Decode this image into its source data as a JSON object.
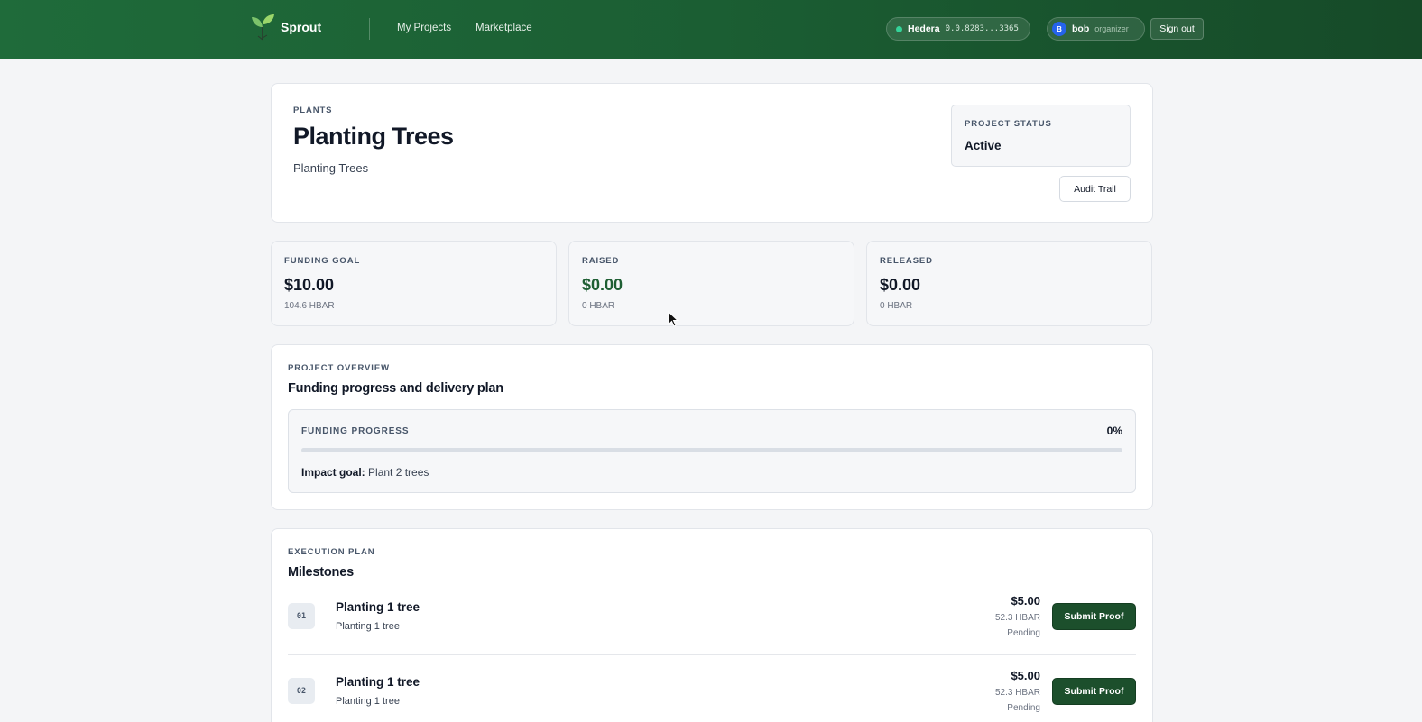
{
  "header": {
    "brand": "Sprout",
    "nav": [
      "My Projects",
      "Marketplace"
    ],
    "network": {
      "name": "Hedera",
      "account": "0.0.8283...3365"
    },
    "user": {
      "initial": "B",
      "name": "bob",
      "role": "organizer"
    },
    "signout_label": "Sign out"
  },
  "project": {
    "category": "PLANTS",
    "title": "Planting Trees",
    "description": "Planting Trees",
    "status_label": "PROJECT STATUS",
    "status": "Active",
    "audit_label": "Audit Trail"
  },
  "stats": [
    {
      "label": "FUNDING GOAL",
      "amount": "$10.00",
      "hbar": "104.6 HBAR"
    },
    {
      "label": "RAISED",
      "amount": "$0.00",
      "hbar": "0 HBAR"
    },
    {
      "label": "RELEASED",
      "amount": "$0.00",
      "hbar": "0 HBAR"
    }
  ],
  "overview": {
    "eyebrow": "PROJECT OVERVIEW",
    "title": "Funding progress and delivery plan",
    "progress_label": "FUNDING PROGRESS",
    "progress_pct": "0%",
    "progress_fraction": 0,
    "impact_label": "Impact goal:",
    "impact_value": "Plant 2 trees"
  },
  "execution": {
    "eyebrow": "EXECUTION PLAN",
    "title": "Milestones",
    "milestones": [
      {
        "num": "01",
        "title": "Planting 1 tree",
        "desc": "Planting 1 tree",
        "amount": "$5.00",
        "hbar": "52.3 HBAR",
        "status": "Pending",
        "action": "Submit Proof"
      },
      {
        "num": "02",
        "title": "Planting 1 tree",
        "desc": "Planting 1 tree",
        "amount": "$5.00",
        "hbar": "52.3 HBAR",
        "status": "Pending",
        "action": "Submit Proof"
      }
    ]
  },
  "colors": {
    "brand_green": "#1f6b3a",
    "button_green": "#1c4f2c",
    "raised_green": "#1f5f34",
    "network_dot": "#34d399",
    "avatar_blue": "#2563eb"
  }
}
